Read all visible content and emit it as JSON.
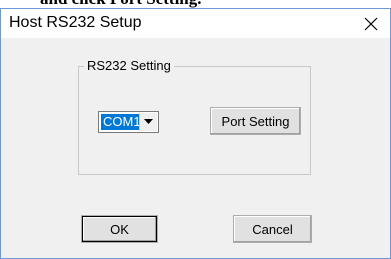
{
  "background_caption": "and click Port Setting.",
  "window": {
    "title": "Host RS232 Setup",
    "close_symbol": "✕"
  },
  "rs232_group": {
    "label": "RS232 Setting",
    "port_select": {
      "selected": "COM1",
      "arrow_icon": "chevron-down-icon"
    },
    "port_setting_label": "Port Setting"
  },
  "footer": {
    "ok_label": "OK",
    "cancel_label": "Cancel"
  },
  "colors": {
    "selection": "#0078d7",
    "window_border": "#6b9bd6",
    "dialog_bg": "#f0f0f0"
  }
}
